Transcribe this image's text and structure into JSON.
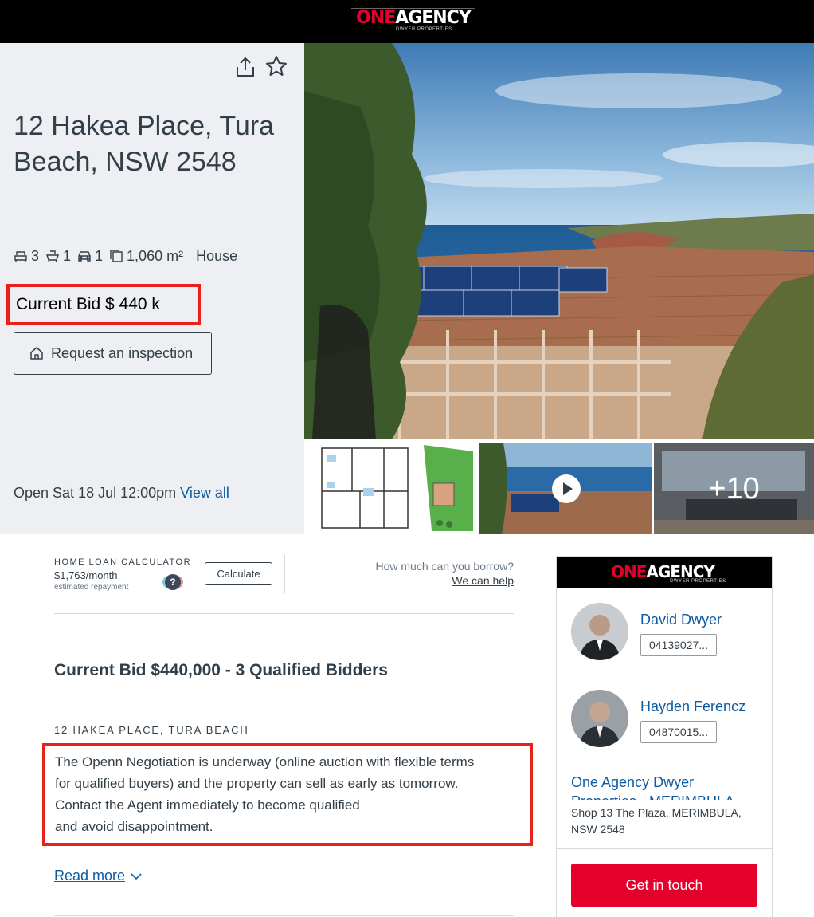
{
  "brand": {
    "primary": "ONE",
    "secondary": "AGENCY",
    "tagline": "DWYER PROPERTIES",
    "colors": {
      "brand_red": "#e4002b",
      "highlight_red": "#e8211a",
      "link_blue": "#0d5ba0",
      "text": "#333f48"
    }
  },
  "listing": {
    "address": "12 Hakea Place, Tura Beach, NSW 2548",
    "features": {
      "bedrooms": "3",
      "bathrooms": "1",
      "car_spaces": "1",
      "land_size": "1,060 m²",
      "property_type": "House"
    },
    "current_bid": "Current Bid $ 440 k",
    "inspection_button": "Request an inspection",
    "open_home": "Open Sat 18 Jul 12:00pm",
    "view_all": "View all",
    "icons": [
      "share-icon",
      "star-icon",
      "bed-icon",
      "bath-icon",
      "car-icon",
      "land-icon",
      "house-icon"
    ]
  },
  "gallery": {
    "more_count": "+10",
    "thumbnails": [
      "floorplan",
      "video",
      "interior"
    ]
  },
  "calculator": {
    "title": "HOME LOAN CALCULATOR",
    "amount": "$1,763",
    "period": "/month",
    "estimate_label": "estimated repayment",
    "help": "?",
    "button": "Calculate",
    "borrow_question": "How much can you borrow?",
    "borrow_link": "We can help"
  },
  "description": {
    "headline": "Current Bid $440,000 - 3 Qualified Bidders",
    "sub_address": "12 HAKEA PLACE, TURA BEACH",
    "lines": [
      "The Openn Negotiation is  underway (online auction with flexible terms",
      "for qualified buyers) and the property can sell as early as tomorrow.",
      "Contact the Agent  immediately to become qualified",
      "and avoid disappointment."
    ],
    "read_more": "Read more"
  },
  "agents": [
    {
      "name": "David Dwyer",
      "phone": "04139027..."
    },
    {
      "name": "Hayden Ferencz",
      "phone": "04870015..."
    }
  ],
  "agency": {
    "name": "One Agency Dwyer Properties - MERIMBULA",
    "address": "Shop 13 The Plaza, MERIMBULA, NSW 2548",
    "contact_button": "Get in touch"
  }
}
